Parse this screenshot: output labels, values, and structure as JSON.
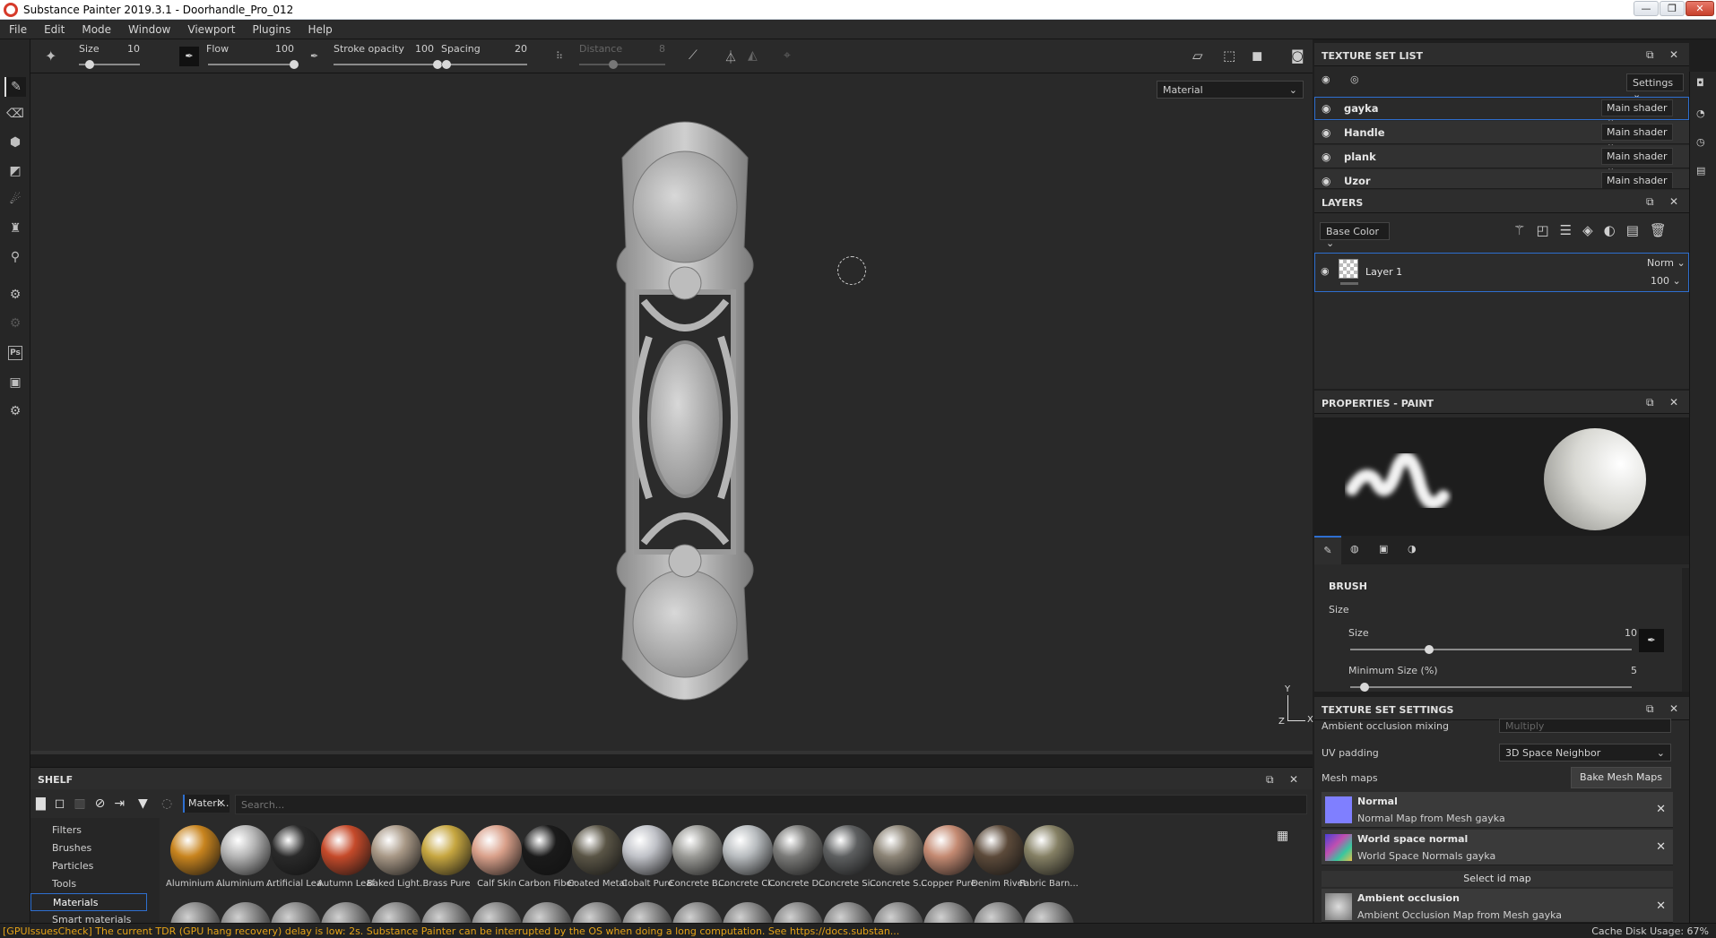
{
  "window": {
    "title": "Substance Painter 2019.3.1 - Doorhandle_Pro_012",
    "controls": [
      "—",
      "❐",
      "✕"
    ]
  },
  "menu": [
    "File",
    "Edit",
    "Mode",
    "Window",
    "Viewport",
    "Plugins",
    "Help"
  ],
  "toolbar": {
    "size_label": "Size",
    "size_value": "10",
    "flow_label": "Flow",
    "flow_value": "100",
    "stroke_opacity_label": "Stroke opacity",
    "stroke_opacity_value": "100",
    "spacing_label": "Spacing",
    "spacing_value": "20",
    "distance_label": "Distance",
    "distance_value": "8",
    "size_fraction": 0.18,
    "flow_fraction": 1.0,
    "stroke_opacity_fraction": 1.0,
    "spacing_fraction": 0.06,
    "distance_fraction": 0.4
  },
  "viewport": {
    "display_mode": "Material",
    "axis_y": "Y",
    "axis_x": "X",
    "axis_z": "Z"
  },
  "texture_set_list": {
    "title": "TEXTURE SET LIST",
    "settings_label": "Settings",
    "items": [
      {
        "name": "gayka",
        "shader": "Main shader",
        "selected": true
      },
      {
        "name": "Handle",
        "shader": "Main shader",
        "selected": false
      },
      {
        "name": "plank",
        "shader": "Main shader",
        "selected": false
      },
      {
        "name": "Uzor",
        "shader": "Main shader",
        "selected": false
      }
    ]
  },
  "layers": {
    "title": "LAYERS",
    "channel": "Base Color",
    "layer_name": "Layer 1",
    "blend_mode": "Norm",
    "opacity": "100"
  },
  "properties": {
    "title": "PROPERTIES - PAINT",
    "section": "BRUSH",
    "subsection": "Size",
    "size_label": "Size",
    "size_value": "10",
    "size_fraction": 0.28,
    "min_size_label": "Minimum Size (%)",
    "min_size_value": "5",
    "min_size_fraction": 0.05
  },
  "texture_set_settings": {
    "title": "TEXTURE SET SETTINGS",
    "ao_mixing_label": "Ambient occlusion mixing",
    "ao_mixing_value": "Multiply",
    "uv_padding_label": "UV padding",
    "uv_padding_value": "3D Space Neighbor",
    "mesh_maps_label": "Mesh maps",
    "bake_button": "Bake Mesh Maps",
    "maps": [
      {
        "title": "Normal",
        "subtitle": "Normal Map from Mesh gayka",
        "color": "#7f7fff"
      },
      {
        "title": "World space normal",
        "subtitle": "World Space Normals gayka",
        "color": "#8a5fd0"
      }
    ],
    "select_id_map": "Select id map",
    "ao_map": {
      "title": "Ambient occlusion",
      "subtitle": "Ambient Occlusion Map from Mesh gayka"
    }
  },
  "shelf": {
    "title": "SHELF",
    "filter_tag": "Materi...",
    "search_placeholder": "Search...",
    "categories": [
      "Filters",
      "Brushes",
      "Particles",
      "Tools",
      "Materials",
      "Smart materials"
    ],
    "selected_category": "Materials",
    "materials": [
      {
        "name": "Aluminium ...",
        "color": "#c8841e"
      },
      {
        "name": "Aluminium ...",
        "color": "#b5b5b5"
      },
      {
        "name": "Artificial Lea...",
        "color": "#2a2a2a"
      },
      {
        "name": "Autumn Leaf",
        "color": "#c54a2a"
      },
      {
        "name": "Baked Light...",
        "color": "#a89886"
      },
      {
        "name": "Brass Pure",
        "color": "#c6a640"
      },
      {
        "name": "Calf Skin",
        "color": "#d9a08a"
      },
      {
        "name": "Carbon Fiber",
        "color": "#1a1a1a"
      },
      {
        "name": "Coated Metal",
        "color": "#5a5546"
      },
      {
        "name": "Cobalt Pure",
        "color": "#c0c2c8"
      },
      {
        "name": "Concrete B...",
        "color": "#9a9a96"
      },
      {
        "name": "Concrete Cl...",
        "color": "#b8bcbf"
      },
      {
        "name": "Concrete D...",
        "color": "#7a7a78"
      },
      {
        "name": "Concrete Si...",
        "color": "#5d5f60"
      },
      {
        "name": "Concrete S...",
        "color": "#8c8476"
      },
      {
        "name": "Copper Pure",
        "color": "#c48a72"
      },
      {
        "name": "Denim Rivet",
        "color": "#5c4a3a"
      },
      {
        "name": "Fabric Barn...",
        "color": "#858064"
      }
    ]
  },
  "status": {
    "message": "[GPUIssuesCheck] The current TDR (GPU hang recovery) delay is low: 2s. Substance Painter can be interrupted by the OS when doing a long computation. See https://docs.substan...",
    "cache": "Cache Disk Usage:   67%"
  }
}
